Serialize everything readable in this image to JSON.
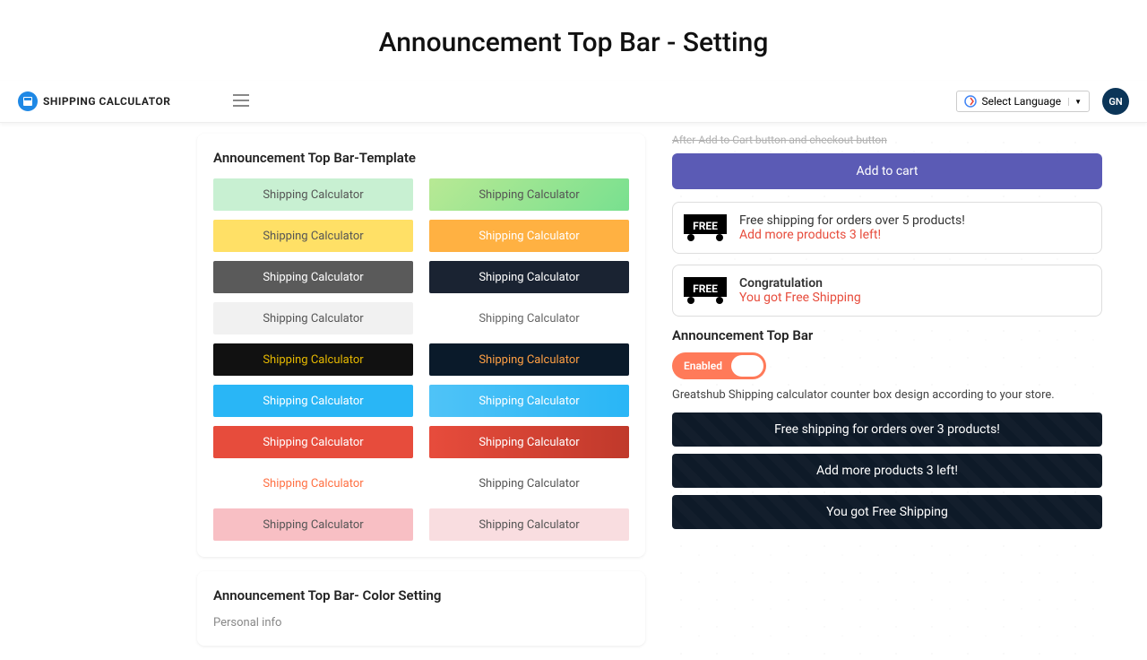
{
  "page_title": "Announcement Top Bar - Setting",
  "brand": {
    "name": "Shipping Calculator"
  },
  "lang_selector": "Select Language",
  "avatar_initials": "GN",
  "templates": {
    "card_title": "Announcement Top Bar-Template",
    "item_label": "Shipping Calculator"
  },
  "color_card": {
    "title": "Announcement Top Bar- Color Setting",
    "subtitle": "Personal info"
  },
  "right": {
    "cut_text": "After Add to Cart button and checkout button",
    "add_cart": "Add to cart",
    "free_badge": "FREE",
    "box1_line1": "Free shipping for orders over 5 products!",
    "box1_line2": "Add more products 3 left!",
    "box2_line1": "Congratulation",
    "box2_line2": "You got Free Shipping",
    "section_label": "Announcement Top Bar",
    "toggle_label": "Enabled",
    "toggle_desc": "Greatshub Shipping calculator counter box design according to your store.",
    "preview1": "Free shipping for orders over 3 products!",
    "preview2": "Add more products 3 left!",
    "preview3": "You got Free Shipping"
  }
}
